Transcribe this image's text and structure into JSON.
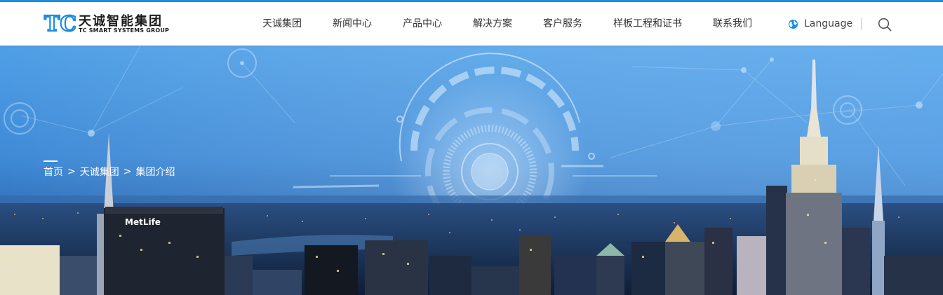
{
  "brand": {
    "logo_letters": "TC",
    "name_cn": "天诚智能集团",
    "name_en": "TC SMART SYSTEMS GROUP",
    "color": "#1a8fe0"
  },
  "nav": {
    "items": [
      {
        "label": "天诚集团"
      },
      {
        "label": "新闻中心"
      },
      {
        "label": "产品中心"
      },
      {
        "label": "解决方案"
      },
      {
        "label": "客户服务"
      },
      {
        "label": "样板工程和证书"
      },
      {
        "label": "联系我们"
      }
    ],
    "language_label": "Language",
    "language_icon": "globe-icon",
    "search_icon": "search-icon"
  },
  "banner": {
    "billboard_text": "MetLife",
    "breadcrumb": [
      {
        "label": "首页"
      },
      {
        "label": "天诚集团"
      },
      {
        "label": "集团介绍"
      }
    ],
    "separator": ">"
  }
}
